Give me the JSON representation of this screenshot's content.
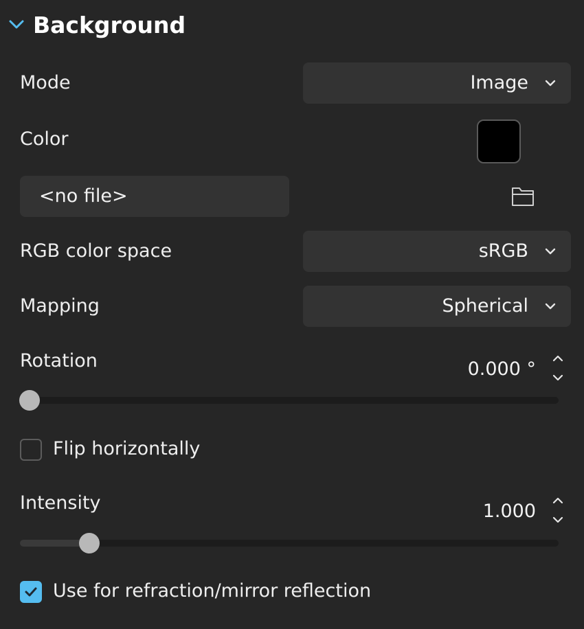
{
  "section": {
    "title": "Background",
    "expanded": true,
    "chevron_icon": "chevron-down-icon",
    "accent_color": "#55bdf0"
  },
  "mode": {
    "label": "Mode",
    "value": "Image"
  },
  "color": {
    "label": "Color",
    "swatch_color": "#000000"
  },
  "file": {
    "value": "<no file>",
    "browse_icon": "folder-icon"
  },
  "color_space": {
    "label": "RGB color space",
    "value": "sRGB"
  },
  "mapping": {
    "label": "Mapping",
    "value": "Spherical"
  },
  "rotation": {
    "label": "Rotation",
    "value_text": "0.000 °",
    "slider_fraction": 0.0
  },
  "flip": {
    "label": "Flip horizontally",
    "checked": false
  },
  "intensity": {
    "label": "Intensity",
    "value_text": "1.000",
    "slider_fraction": 0.115
  },
  "refraction": {
    "label": "Use for refraction/mirror reflection",
    "checked": true
  }
}
